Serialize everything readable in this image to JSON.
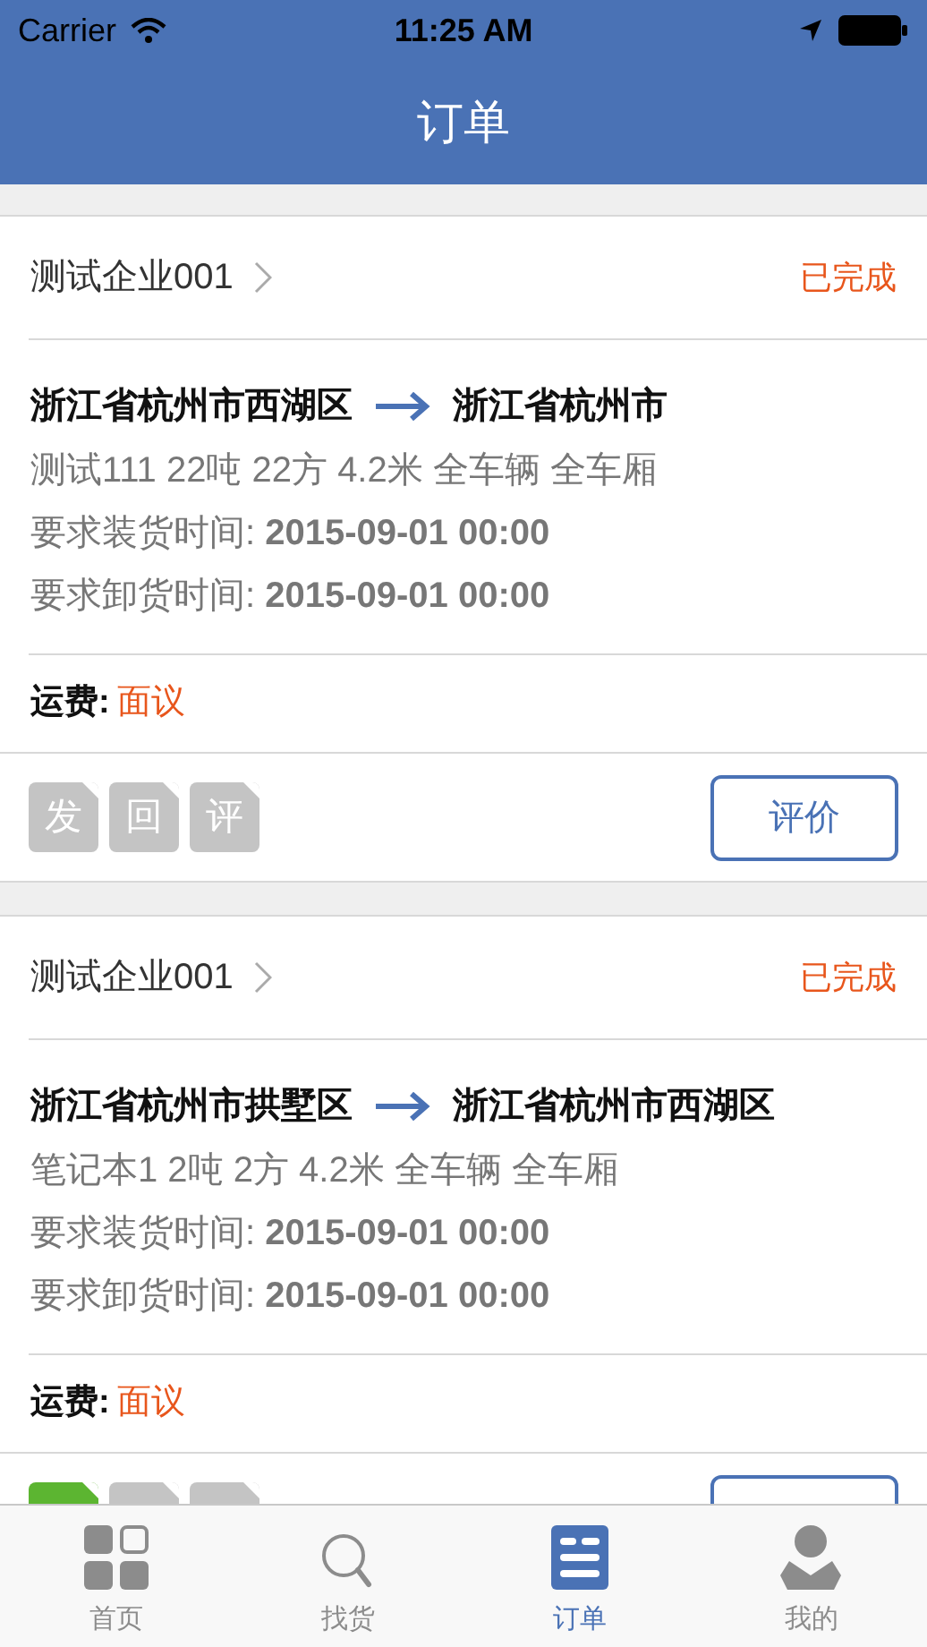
{
  "status_bar": {
    "carrier": "Carrier",
    "time": "11:25 AM"
  },
  "nav": {
    "title": "订单"
  },
  "orders": [
    {
      "company": "测试企业001",
      "status": "已完成",
      "from": "浙江省杭州市西湖区",
      "to": "浙江省杭州市",
      "cargo": "测试111 22吨 22方 4.2米 全车辆 全车厢",
      "load_time": "要求装货时间: **2015-09-01 00:00**",
      "unload_time": "要求卸货时间: **2015-09-01 00:00**",
      "fee_label": "运费:",
      "fee_value": "面议",
      "badges": [
        {
          "label": "发",
          "active": false
        },
        {
          "label": "回",
          "active": false
        },
        {
          "label": "评",
          "active": false
        }
      ],
      "button_label": "评价"
    },
    {
      "company": "测试企业001",
      "status": "已完成",
      "from": "浙江省杭州市拱墅区",
      "to": "浙江省杭州市西湖区",
      "cargo": "笔记本1 2吨 2方 4.2米 全车辆 全车厢",
      "load_time": "要求装货时间: **2015-09-01 00:00**",
      "unload_time": "要求卸货时间: **2015-09-01 00:00**",
      "fee_label": "运费:",
      "fee_value": "面议",
      "badges": [
        {
          "active": true
        },
        {
          "active": false
        },
        {
          "active": false
        }
      ]
    }
  ],
  "tabs": [
    {
      "label": "首页",
      "kind": "grid",
      "selected": false
    },
    {
      "label": "找货",
      "kind": "search",
      "selected": false
    },
    {
      "label": "订单",
      "kind": "list",
      "selected": true
    },
    {
      "label": "我的",
      "kind": "user",
      "selected": false
    }
  ]
}
